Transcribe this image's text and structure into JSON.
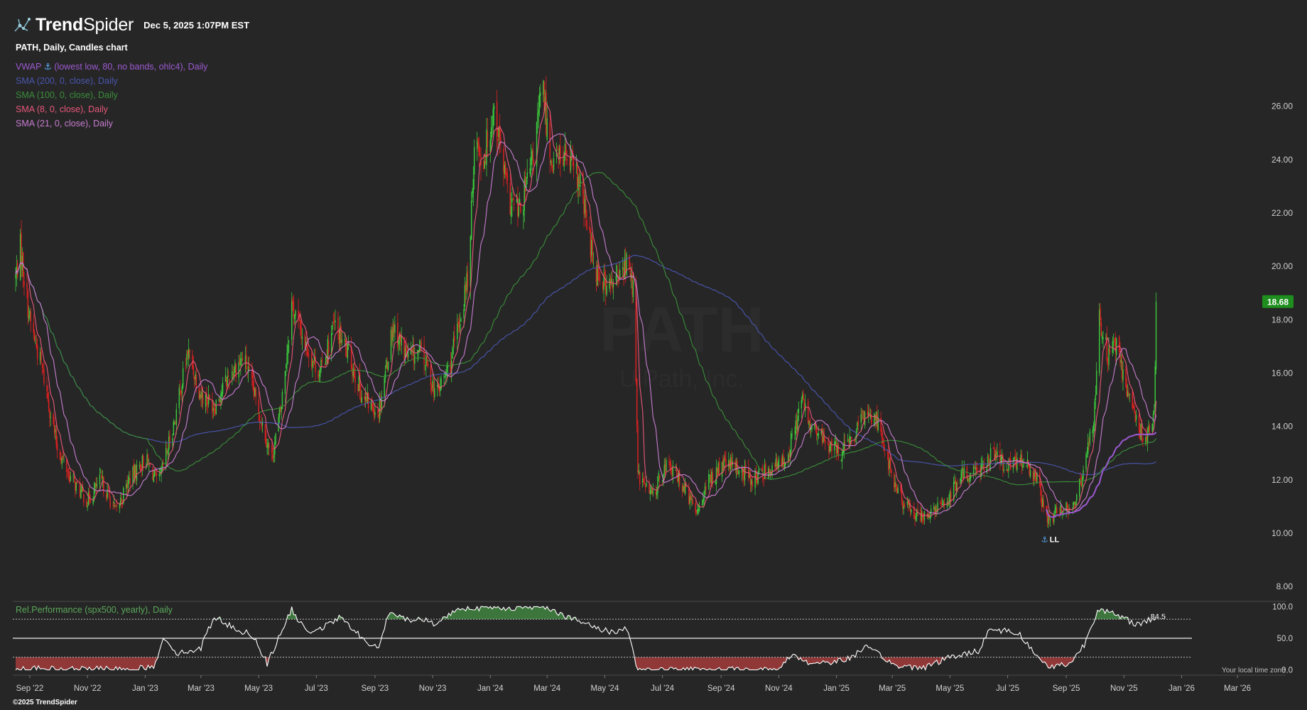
{
  "header": {
    "brand_part1": "Trend",
    "brand_part2": "Spider",
    "timestamp": "Dec 5, 2025 1:07PM EST"
  },
  "chart_title": "PATH, Daily, Candles chart",
  "watermark": {
    "symbol": "PATH",
    "name": "UiPath, Inc."
  },
  "legend": [
    {
      "label": "VWAP",
      "has_anchor": true,
      "rest": " (lowest low, 80, no bands, ohlc4), Daily",
      "color": "#9b59d0"
    },
    {
      "label": "SMA (200, 0, close), Daily",
      "color": "#4a56b0"
    },
    {
      "label": "SMA (100, 0, close), Daily",
      "color": "#3a8f3a"
    },
    {
      "label": "SMA (8, 0, close), Daily",
      "color": "#e8577a"
    },
    {
      "label": "SMA (21, 0, close), Daily",
      "color": "#c77dd1"
    }
  ],
  "last_price": {
    "label": "18.68",
    "color": "#1e8e1e"
  },
  "anchor_marker": "LL",
  "indicator": {
    "label": "Rel.Performance (spx500, yearly), Daily",
    "last_value_label": "84.5",
    "y_ticks": [
      "100.0",
      "50.0",
      "0.0"
    ]
  },
  "x_ticks": [
    "Sep '22",
    "Nov '22",
    "Jan '23",
    "Mar '23",
    "May '23",
    "Jul '23",
    "Sep '23",
    "Nov '23",
    "Jan '24",
    "Mar '24",
    "May '24",
    "Jul '24",
    "Sep '24",
    "Nov '24",
    "Jan '25",
    "Mar '25",
    "May '25",
    "Jul '25",
    "Sep '25",
    "Nov '25",
    "Jan '26",
    "Mar '26"
  ],
  "local_time_note": "Your local time zone",
  "footer": "©2025 TrendSpider",
  "colors": {
    "background": "#262626",
    "candle_up": "#3cc83c",
    "candle_down": "#e02020",
    "sma200": "#4a56b0",
    "sma100": "#3a8f3a",
    "sma8": "#e8577a",
    "sma21": "#c77dd1",
    "vwap": "#9b59d0",
    "indicator_line": "#ffffff",
    "zone_high": "#3f7f3f",
    "zone_low": "#9c3b3b"
  },
  "chart_data": {
    "type": "candlestick",
    "interval": "Daily",
    "title": "PATH, Daily, Candles chart",
    "ylim": [
      7.5,
      27.8
    ],
    "y_ticks": [
      8,
      10,
      12,
      14,
      16,
      18,
      20,
      22,
      24,
      26
    ],
    "x_range": [
      "2022-08-17",
      "2026-03-31"
    ],
    "last_price": 18.68,
    "price_path": [
      [
        "2022-08-17",
        19.6
      ],
      [
        "2022-08-22",
        20.7
      ],
      [
        "2022-09-01",
        18.0
      ],
      [
        "2022-09-15",
        16.0
      ],
      [
        "2022-09-30",
        13.2
      ],
      [
        "2022-10-15",
        12.0
      ],
      [
        "2022-11-01",
        11.2
      ],
      [
        "2022-11-15",
        12.0
      ],
      [
        "2022-12-01",
        10.8
      ],
      [
        "2022-12-15",
        12.0
      ],
      [
        "2023-01-01",
        12.8
      ],
      [
        "2023-01-15",
        11.8
      ],
      [
        "2023-02-01",
        14.2
      ],
      [
        "2023-02-15",
        16.8
      ],
      [
        "2023-03-01",
        15.2
      ],
      [
        "2023-03-15",
        14.8
      ],
      [
        "2023-04-01",
        16.0
      ],
      [
        "2023-04-15",
        16.6
      ],
      [
        "2023-05-01",
        14.6
      ],
      [
        "2023-05-15",
        12.8
      ],
      [
        "2023-05-25",
        14.8
      ],
      [
        "2023-06-05",
        18.6
      ],
      [
        "2023-06-20",
        17.0
      ],
      [
        "2023-07-05",
        16.0
      ],
      [
        "2023-07-20",
        17.8
      ],
      [
        "2023-08-05",
        16.6
      ],
      [
        "2023-08-20",
        15.0
      ],
      [
        "2023-09-05",
        14.6
      ],
      [
        "2023-09-20",
        17.8
      ],
      [
        "2023-10-05",
        16.6
      ],
      [
        "2023-10-20",
        16.8
      ],
      [
        "2023-11-05",
        15.2
      ],
      [
        "2023-11-20",
        16.4
      ],
      [
        "2023-12-01",
        18.2
      ],
      [
        "2023-12-10",
        20.0
      ],
      [
        "2023-12-15",
        24.8
      ],
      [
        "2023-12-25",
        24.0
      ],
      [
        "2024-01-05",
        26.0
      ],
      [
        "2024-01-20",
        22.5
      ],
      [
        "2024-02-01",
        22.0
      ],
      [
        "2024-02-15",
        24.0
      ],
      [
        "2024-02-25",
        26.8
      ],
      [
        "2024-03-05",
        24.0
      ],
      [
        "2024-03-20",
        24.2
      ],
      [
        "2024-04-05",
        23.0
      ],
      [
        "2024-04-20",
        20.0
      ],
      [
        "2024-05-05",
        19.2
      ],
      [
        "2024-05-15",
        19.5
      ],
      [
        "2024-05-25",
        20.2
      ],
      [
        "2024-06-01",
        19.0
      ],
      [
        "2024-06-05",
        12.2
      ],
      [
        "2024-06-20",
        11.4
      ],
      [
        "2024-07-05",
        12.6
      ],
      [
        "2024-07-20",
        12.0
      ],
      [
        "2024-08-05",
        10.8
      ],
      [
        "2024-08-20",
        12.0
      ],
      [
        "2024-09-05",
        12.6
      ],
      [
        "2024-09-20",
        12.4
      ],
      [
        "2024-10-05",
        12.0
      ],
      [
        "2024-10-20",
        12.4
      ],
      [
        "2024-11-05",
        12.6
      ],
      [
        "2024-11-15",
        13.5
      ],
      [
        "2024-11-25",
        15.0
      ],
      [
        "2024-12-05",
        14.0
      ],
      [
        "2024-12-20",
        13.4
      ],
      [
        "2025-01-05",
        13.0
      ],
      [
        "2025-01-20",
        13.6
      ],
      [
        "2025-02-01",
        14.6
      ],
      [
        "2025-02-15",
        14.2
      ],
      [
        "2025-03-01",
        12.0
      ],
      [
        "2025-03-15",
        11.0
      ],
      [
        "2025-04-01",
        10.6
      ],
      [
        "2025-04-15",
        10.8
      ],
      [
        "2025-05-01",
        11.4
      ],
      [
        "2025-05-15",
        12.2
      ],
      [
        "2025-06-01",
        12.4
      ],
      [
        "2025-06-15",
        13.0
      ],
      [
        "2025-07-01",
        12.4
      ],
      [
        "2025-07-15",
        12.8
      ],
      [
        "2025-08-01",
        12.0
      ],
      [
        "2025-08-10",
        10.6
      ],
      [
        "2025-08-25",
        10.8
      ],
      [
        "2025-09-10",
        11.2
      ],
      [
        "2025-09-20",
        12.4
      ],
      [
        "2025-10-01",
        14.6
      ],
      [
        "2025-10-05",
        18.2
      ],
      [
        "2025-10-15",
        16.6
      ],
      [
        "2025-10-25",
        17.0
      ],
      [
        "2025-11-05",
        15.2
      ],
      [
        "2025-11-15",
        14.0
      ],
      [
        "2025-11-25",
        13.6
      ],
      [
        "2025-12-03",
        14.6
      ],
      [
        "2025-12-04",
        16.0
      ],
      [
        "2025-12-05",
        18.68
      ]
    ],
    "indicator": {
      "name": "Rel.Performance (spx500, yearly)",
      "ylim": [
        -5,
        107
      ],
      "levels": [
        80,
        50,
        20
      ],
      "last_value": 84.5,
      "path": [
        [
          "2022-08-17",
          2
        ],
        [
          "2022-10-01",
          1
        ],
        [
          "2022-12-01",
          1
        ],
        [
          "2023-01-10",
          3
        ],
        [
          "2023-01-20",
          52
        ],
        [
          "2023-02-05",
          25
        ],
        [
          "2023-03-01",
          35
        ],
        [
          "2023-03-15",
          85
        ],
        [
          "2023-04-05",
          65
        ],
        [
          "2023-04-25",
          55
        ],
        [
          "2023-05-10",
          10
        ],
        [
          "2023-05-25",
          60
        ],
        [
          "2023-06-05",
          95
        ],
        [
          "2023-06-20",
          60
        ],
        [
          "2023-07-10",
          68
        ],
        [
          "2023-07-25",
          82
        ],
        [
          "2023-08-10",
          65
        ],
        [
          "2023-08-20",
          45
        ],
        [
          "2023-09-05",
          35
        ],
        [
          "2023-09-15",
          88
        ],
        [
          "2023-10-05",
          80
        ],
        [
          "2023-10-20",
          80
        ],
        [
          "2023-11-05",
          72
        ],
        [
          "2023-11-15",
          85
        ],
        [
          "2023-12-01",
          98
        ],
        [
          "2024-01-15",
          98
        ],
        [
          "2024-03-01",
          100
        ],
        [
          "2024-03-20",
          85
        ],
        [
          "2024-04-15",
          70
        ],
        [
          "2024-05-05",
          60
        ],
        [
          "2024-05-25",
          65
        ],
        [
          "2024-06-05",
          0
        ],
        [
          "2024-08-01",
          0
        ],
        [
          "2024-10-01",
          0
        ],
        [
          "2024-11-01",
          0
        ],
        [
          "2024-11-15",
          25
        ],
        [
          "2024-12-05",
          10
        ],
        [
          "2025-01-10",
          15
        ],
        [
          "2025-02-01",
          35
        ],
        [
          "2025-02-20",
          20
        ],
        [
          "2025-03-05",
          5
        ],
        [
          "2025-04-05",
          5
        ],
        [
          "2025-05-01",
          20
        ],
        [
          "2025-06-01",
          30
        ],
        [
          "2025-06-10",
          63
        ],
        [
          "2025-07-01",
          62
        ],
        [
          "2025-07-15",
          55
        ],
        [
          "2025-08-01",
          20
        ],
        [
          "2025-08-15",
          5
        ],
        [
          "2025-09-05",
          10
        ],
        [
          "2025-09-20",
          40
        ],
        [
          "2025-10-05",
          98
        ],
        [
          "2025-10-25",
          85
        ],
        [
          "2025-11-15",
          72
        ],
        [
          "2025-12-01",
          80
        ],
        [
          "2025-12-05",
          84.5
        ]
      ]
    },
    "series": [
      {
        "name": "SMA (200, 0, close), Daily",
        "key": "sma200"
      },
      {
        "name": "SMA (100, 0, close), Daily",
        "key": "sma100"
      },
      {
        "name": "SMA (8, 0, close), Daily",
        "key": "sma8"
      },
      {
        "name": "SMA (21, 0, close), Daily",
        "key": "sma21"
      },
      {
        "name": "VWAP (lowest low, 80, no bands, ohlc4), Daily",
        "key": "vwap",
        "start": "2025-08-10"
      }
    ]
  }
}
